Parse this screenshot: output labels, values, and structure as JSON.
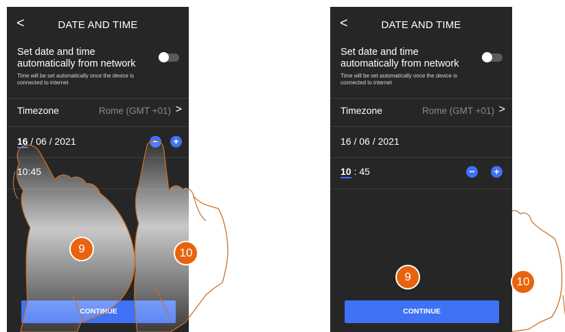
{
  "screens": [
    {
      "title": "DATE AND TIME",
      "back_glyph": "<",
      "auto_label": "Set date and time automatically from network",
      "auto_note": "Time will be set automatically once the device is connected to internet",
      "timezone_label": "Timezone",
      "timezone_value": "Rome (GMT +01)",
      "date_day": "16",
      "date_rest": " / 06 / 2021",
      "time_hour": "10",
      "time_rest": ":45",
      "minus_glyph": "−",
      "plus_glyph": "+",
      "continue_label": "CONTINUE",
      "badge_left": "9",
      "badge_right": "10"
    },
    {
      "title": "DATE AND TIME",
      "back_glyph": "<",
      "auto_label": "Set date and time automatically from network",
      "auto_note": "Time will be set automatically once the device is connected to internet",
      "timezone_label": "Timezone",
      "timezone_value": "Rome (GMT +01)",
      "date_value": "16 / 06 / 2021",
      "time_hour": "10",
      "time_rest": " : 45",
      "minus_glyph": "−",
      "plus_glyph": "+",
      "continue_label": "CONTINUE",
      "badge_left": "9",
      "badge_right": "10"
    }
  ],
  "colors": {
    "screen_bg": "#262626",
    "accent": "#3f72f5",
    "badge": "#e9630e",
    "hand_outline": "#c8702a"
  },
  "icons": [
    "back-chevron-icon",
    "toggle-switch",
    "chevron-right-icon",
    "minus-circle-icon",
    "plus-circle-icon",
    "pointing-hand-illustration"
  ]
}
